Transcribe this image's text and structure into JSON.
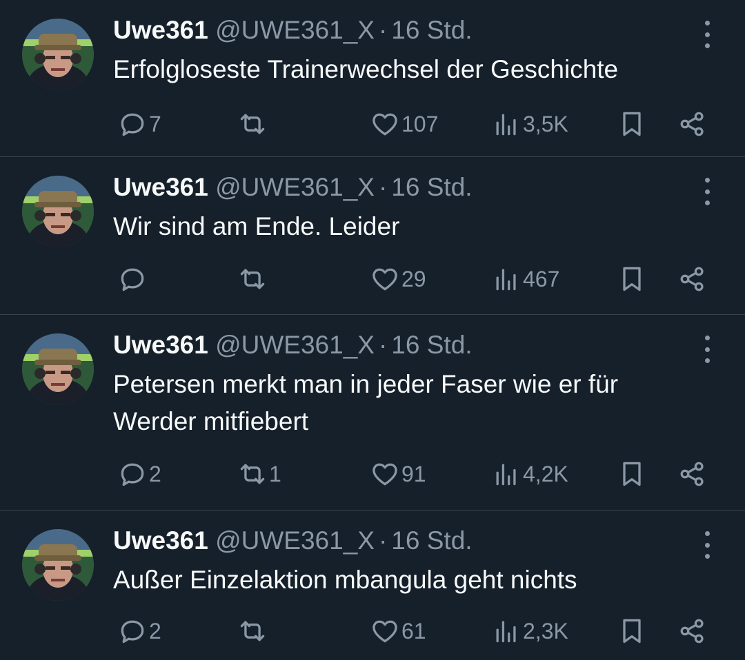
{
  "colors": {
    "background": "#15202b",
    "text_primary": "#f7f9f9",
    "text_secondary": "#8b98a5",
    "divider": "#38444d"
  },
  "icons": {
    "reply": "reply-icon",
    "retweet": "retweet-icon",
    "like": "heart-icon",
    "views": "views-icon",
    "bookmark": "bookmark-icon",
    "share": "share-icon",
    "more": "more-icon"
  },
  "tweets": [
    {
      "name": "Uwe361",
      "handle": "@UWE361_X",
      "separator": "·",
      "time": "16 Std.",
      "text": "Erfolgloseste Trainerwechsel der Geschichte",
      "replies": "7",
      "retweets": "",
      "likes": "107",
      "views": "3,5K"
    },
    {
      "name": "Uwe361",
      "handle": "@UWE361_X",
      "separator": "·",
      "time": "16 Std.",
      "text": "Wir sind am Ende. Leider",
      "replies": "",
      "retweets": "",
      "likes": "29",
      "views": "467"
    },
    {
      "name": "Uwe361",
      "handle": "@UWE361_X",
      "separator": "·",
      "time": "16 Std.",
      "text": "Petersen merkt man in jeder Faser wie er für Werder mitfiebert",
      "replies": "2",
      "retweets": "1",
      "likes": "91",
      "views": "4,2K"
    },
    {
      "name": "Uwe361",
      "handle": "@UWE361_X",
      "separator": "·",
      "time": "16 Std.",
      "text": "Außer Einzelaktion mbangula geht nichts",
      "replies": "2",
      "retweets": "",
      "likes": "61",
      "views": "2,3K"
    }
  ]
}
